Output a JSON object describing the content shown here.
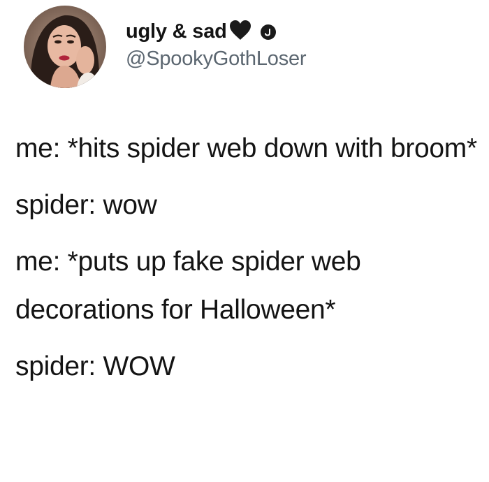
{
  "user": {
    "display_name": "ugly & sad",
    "handle": "@SpookyGothLoser",
    "heart_icon": "black-heart-icon",
    "badge_icon": "verified-badge-icon"
  },
  "tweet": {
    "lines": [
      "me: *hits spider web down with broom*",
      "spider: wow",
      "me: *puts up fake spider web decorations for Halloween*",
      "spider: WOW"
    ]
  },
  "colors": {
    "text": "#141414",
    "handle": "#5b6670",
    "background": "#ffffff"
  }
}
